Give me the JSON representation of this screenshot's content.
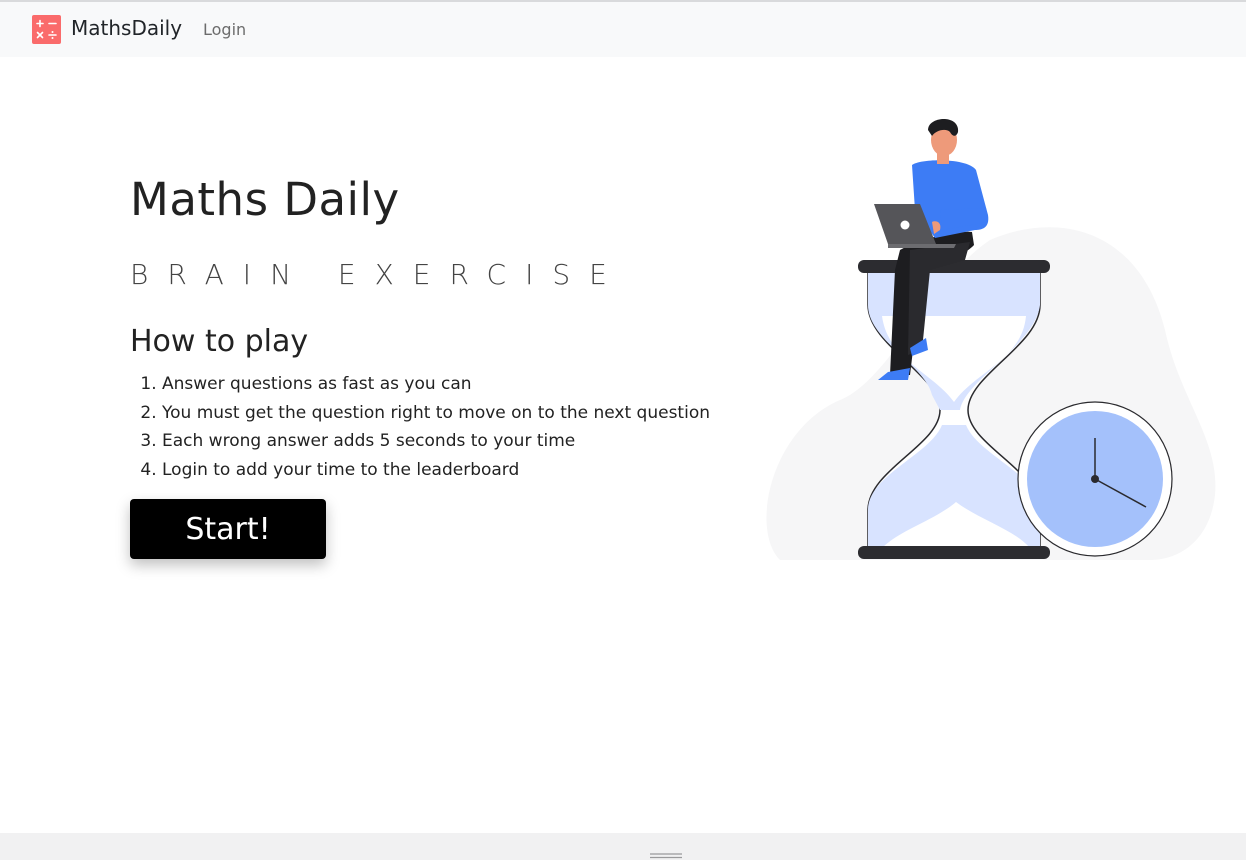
{
  "navbar": {
    "brand_name": "MathsDaily",
    "login_label": "Login",
    "logo_icon": "calculator-icon"
  },
  "hero": {
    "title": "Maths Daily",
    "subtitle": "BRAIN EXERCISE",
    "howto_heading": "How to play",
    "rules": [
      "Answer questions as fast as you can",
      "You must get the question right to move on to the next question",
      "Each wrong answer adds 5 seconds to your time",
      "Login to add your time to the leaderboard"
    ],
    "start_label": "Start!"
  },
  "illustration": {
    "icon": "person-on-hourglass-with-clock-illustration"
  },
  "colors": {
    "brand_accent": "#fa6b6b",
    "navbar_bg": "#f8f9fa",
    "button_bg": "#000000",
    "illustration_blue": "#3d7cf5",
    "illustration_light_blue": "#d5e2ff",
    "clock_blue": "#a4c1fb"
  }
}
